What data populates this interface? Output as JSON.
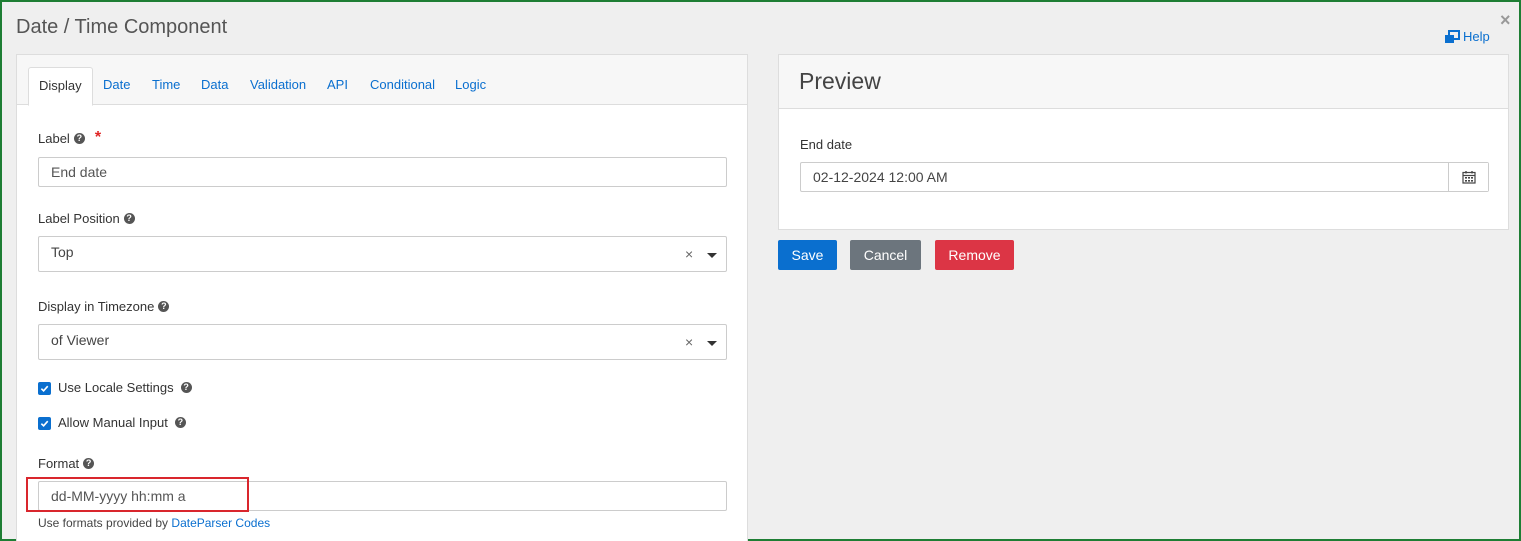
{
  "dialog": {
    "title": "Date / Time Component",
    "close_label": "×",
    "help_label": "Help"
  },
  "tabs": [
    {
      "label": "Display",
      "active": true
    },
    {
      "label": "Date",
      "active": false
    },
    {
      "label": "Time",
      "active": false
    },
    {
      "label": "Data",
      "active": false
    },
    {
      "label": "Validation",
      "active": false
    },
    {
      "label": "API",
      "active": false
    },
    {
      "label": "Conditional",
      "active": false
    },
    {
      "label": "Logic",
      "active": false
    }
  ],
  "form": {
    "label_field": {
      "label": "Label",
      "required_mark": "*",
      "value": "End date"
    },
    "label_position": {
      "label": "Label Position",
      "value": "Top",
      "clear": "×"
    },
    "timezone": {
      "label": "Display in Timezone",
      "value": "of Viewer",
      "clear": "×"
    },
    "use_locale": {
      "label": "Use Locale Settings",
      "checked": true
    },
    "manual_input": {
      "label": "Allow Manual Input",
      "checked": true
    },
    "format": {
      "label": "Format",
      "value": "dd-MM-yyyy hh:mm a",
      "help_prefix": "Use formats provided by",
      "help_link": "DateParser Codes"
    },
    "help_glyph": "?"
  },
  "preview": {
    "title": "Preview",
    "field_label": "End date",
    "field_value": "02-12-2024 12:00 AM"
  },
  "buttons": {
    "save": "Save",
    "cancel": "Cancel",
    "remove": "Remove"
  },
  "colors": {
    "frame_border": "#1e7e34",
    "primary": "#0a6fcf",
    "secondary": "#6c757d",
    "danger": "#dc3545",
    "highlight": "#d9262d"
  },
  "icons": {
    "help": "help-window-icon",
    "calendar": "calendar-icon",
    "question": "question-circle-icon",
    "check": "check-icon"
  }
}
